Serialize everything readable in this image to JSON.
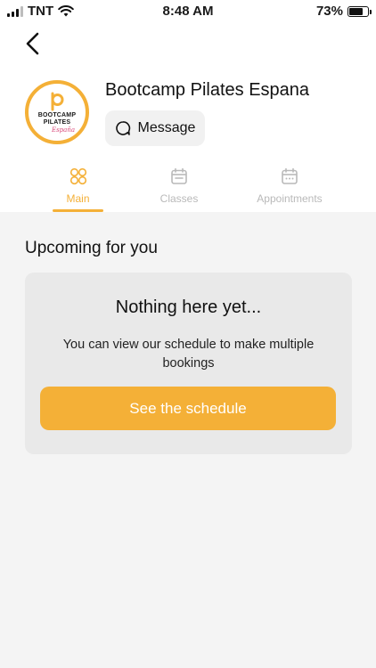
{
  "status_bar": {
    "carrier": "TNT",
    "time": "8:48 AM",
    "battery": "73%",
    "battery_level": 0.73
  },
  "header": {
    "studio_name": "Bootcamp Pilates Espana",
    "message_label": "Message",
    "logo": {
      "line1": "BOOTCAMP",
      "line2": "PILATES",
      "line3": "España"
    }
  },
  "tabs": [
    {
      "label": "Main",
      "icon": "grid-icon",
      "active": true
    },
    {
      "label": "Classes",
      "icon": "calendar-icon",
      "active": false
    },
    {
      "label": "Appointments",
      "icon": "calendar-dots-icon",
      "active": false
    }
  ],
  "main": {
    "section_title": "Upcoming for you",
    "empty_title": "Nothing here yet...",
    "empty_text": "You can view our schedule to make multiple bookings",
    "cta_label": "See the schedule"
  },
  "colors": {
    "accent": "#f4b037",
    "tab_inactive": "#b9b9b9",
    "background": "#f4f4f4",
    "card": "#e9e9e9"
  }
}
